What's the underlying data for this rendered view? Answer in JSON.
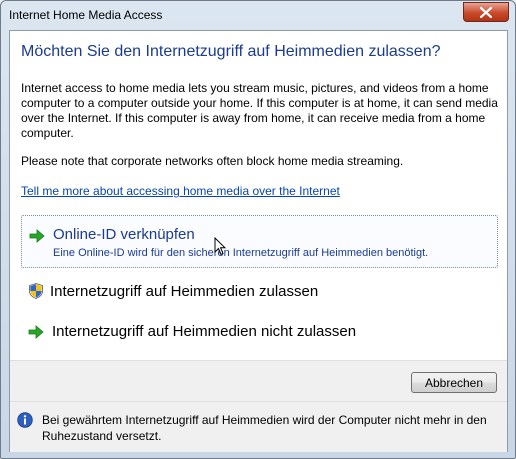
{
  "window": {
    "title": "Internet Home Media Access"
  },
  "heading": "Möchten Sie den Internetzugriff auf Heimmedien zulassen?",
  "body": "Internet access to home media lets you stream music, pictures, and videos from a home computer to a computer outside your home.  If this computer is at home, it can send media over the Internet.  If this computer is away from home, it can receive media from a home computer.",
  "note": "Please note that corporate networks often block home media streaming.",
  "help_link": "Tell me more about accessing home media over the Internet",
  "options": [
    {
      "icon": "green-arrow-icon",
      "title": "Online-ID verknüpfen",
      "description": "Eine Online-ID wird für den sicheren Internetzugriff auf Heimmedien benötigt."
    },
    {
      "icon": "uac-shield-icon",
      "title": "Internetzugriff auf Heimmedien zulassen"
    },
    {
      "icon": "green-arrow-icon",
      "title": "Internetzugriff auf Heimmedien nicht zulassen"
    }
  ],
  "cancel_label": "Abbrechen",
  "info": {
    "icon": "info-icon",
    "text": "Bei gewährtem Internetzugriff auf Heimmedien wird der Computer nicht mehr in den Ruhezustand versetzt."
  },
  "colors": {
    "accent": "#1b3b8f",
    "link": "#0645ad",
    "close_button": "#c9492c",
    "arrow": "#2aa52a"
  }
}
